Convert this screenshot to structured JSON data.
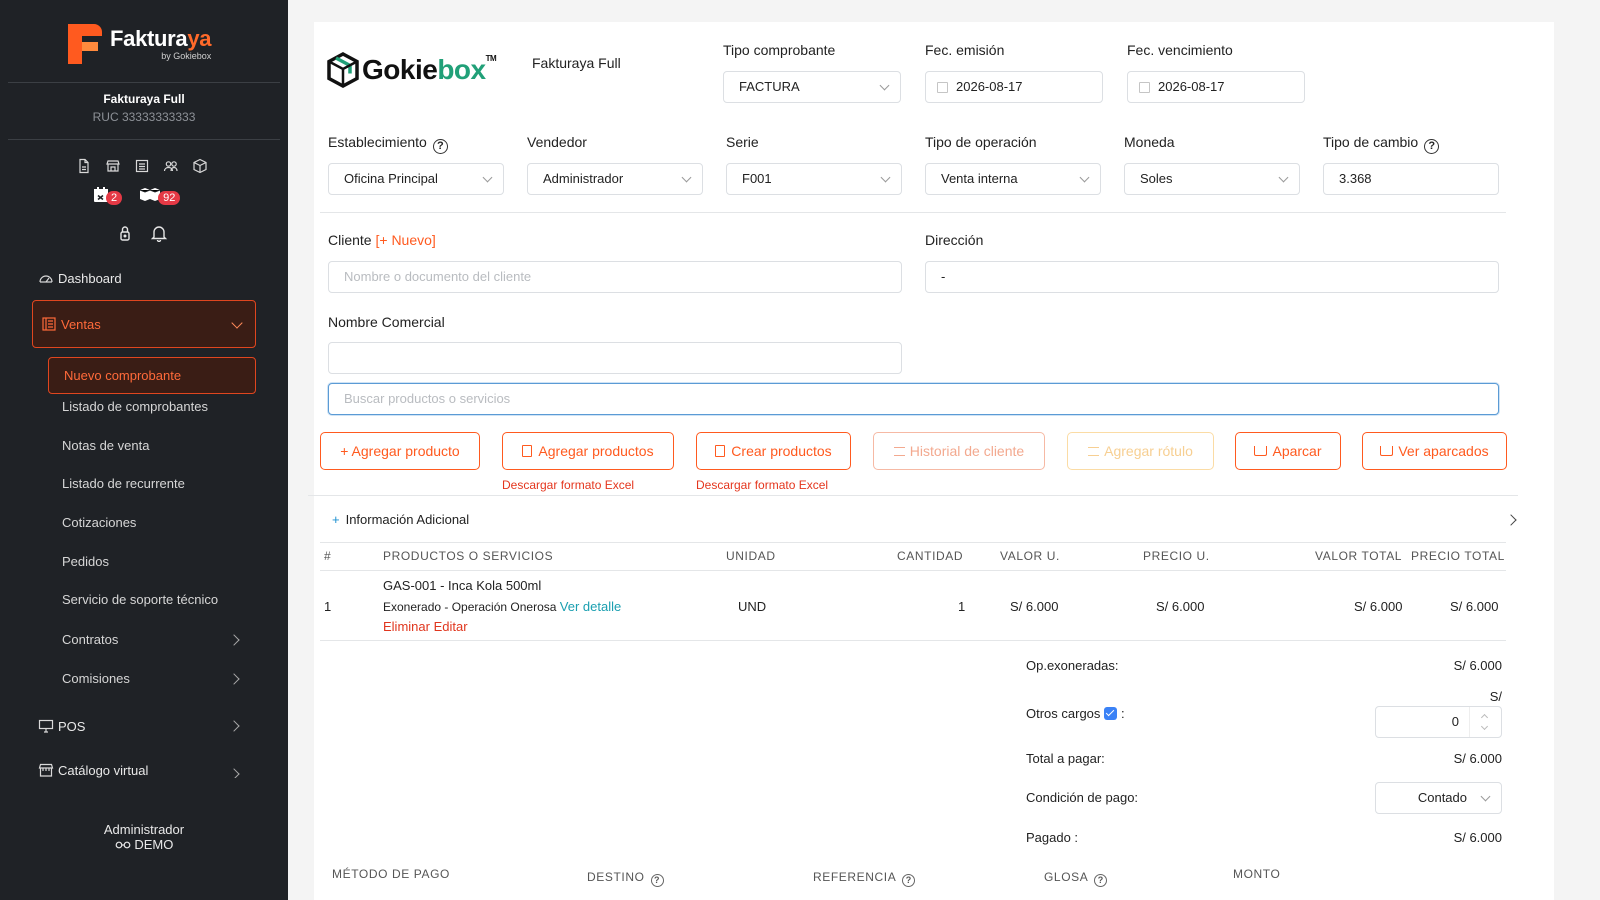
{
  "sidebar": {
    "brand_main": "Faktura",
    "brand_accent": "ya",
    "brand_sub": "by Gokiebox",
    "company_name": "Fakturaya Full",
    "company_ruc": "RUC 33333333333",
    "badges": {
      "calendar": "2",
      "boxes": "92"
    },
    "menu": {
      "dashboard": "Dashboard",
      "ventas": "Ventas",
      "nuevo": "Nuevo comprobante",
      "listado": "Listado de comprobantes",
      "notas": "Notas de venta",
      "recurrente": "Listado de recurrente",
      "cotizaciones": "Cotizaciones",
      "pedidos": "Pedidos",
      "soporte": "Servicio de soporte técnico",
      "contratos": "Contratos",
      "comisiones": "Comisiones",
      "pos": "POS",
      "catalogo": "Catálogo virtual"
    },
    "footer_user": "Administrador",
    "footer_mode": "DEMO"
  },
  "header": {
    "brand_a": "Gokie",
    "brand_b": "box",
    "brand_tm": "TM",
    "plan": "Fakturaya Full"
  },
  "form": {
    "tipo_label": "Tipo comprobante",
    "tipo_value": "FACTURA",
    "emision_label": "Fec. emisión",
    "emision_value": "2026-08-17",
    "vencimiento_label": "Fec. vencimiento",
    "vencimiento_value": "2026-08-17",
    "establecimiento_label": "Establecimiento",
    "establecimiento_value": "Oficina Principal",
    "vendedor_label": "Vendedor",
    "vendedor_value": "Administrador",
    "serie_label": "Serie",
    "serie_value": "F001",
    "operacion_label": "Tipo de operación",
    "operacion_value": "Venta interna",
    "moneda_label": "Moneda",
    "moneda_value": "Soles",
    "cambio_label": "Tipo de cambio",
    "cambio_value": "3.368",
    "cliente_label": "Cliente",
    "cliente_nuevo": "[+ Nuevo]",
    "cliente_placeholder": "Nombre o documento del cliente",
    "direccion_label": "Dirección",
    "direccion_value": "-",
    "comercial_label": "Nombre Comercial",
    "comercial_value": "",
    "buscar_placeholder": "Buscar productos o servicios"
  },
  "actions": {
    "agregar_producto": "+ Agregar producto",
    "agregar_productos": "Agregar productos",
    "crear_productos": "Crear productos",
    "historial": "Historial de cliente",
    "rotulo": "Agregar rótulo",
    "aparcar": "Aparcar",
    "ver_aparcados": "Ver aparcados",
    "excel_1": "Descargar formato Excel",
    "excel_2": "Descargar formato Excel"
  },
  "info_adicional": "Información Adicional",
  "table": {
    "headers": [
      "#",
      "PRODUCTOS O SERVICIOS",
      "UNIDAD",
      "CANTIDAD",
      "VALOR U.",
      "PRECIO U.",
      "VALOR TOTAL",
      "PRECIO TOTAL"
    ],
    "rows": [
      {
        "n": "1",
        "product": "GAS-001 - Inca Kola 500ml",
        "tax": "Exonerado - Operación Onerosa",
        "detail": "Ver detalle",
        "delete": "Eliminar",
        "edit": "Editar",
        "unit": "UND",
        "qty": "1",
        "valor_u": "S/ 6.000",
        "precio_u": "S/ 6.000",
        "valor_total": "S/ 6.000",
        "precio_total": "S/ 6.000"
      }
    ]
  },
  "totals": {
    "exoneradas_label": "Op.exoneradas:",
    "exoneradas_value": "S/ 6.000",
    "otros_label": "Otros cargos",
    "otros_currency": "S/",
    "otros_value": "0",
    "total_label": "Total a pagar:",
    "total_value": "S/ 6.000",
    "condicion_label": "Condición de pago:",
    "condicion_value": "Contado",
    "pagado_label": "Pagado :",
    "pagado_value": "S/ 6.000"
  },
  "payment_headers": [
    "MÉTODO DE PAGO",
    "DESTINO",
    "REFERENCIA",
    "GLOSA",
    "MONTO"
  ],
  "colors": {
    "accent": "#ff5a1f",
    "sidebar_bg": "#1f2226",
    "brand_green": "#21a078",
    "link_teal": "#1a9fb0",
    "badge_red": "#e53945"
  }
}
